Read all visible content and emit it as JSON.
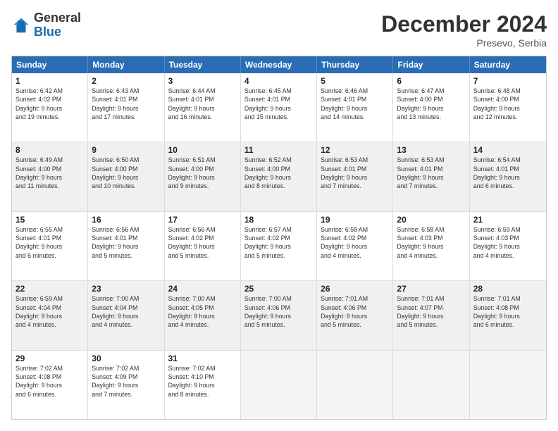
{
  "logo": {
    "general": "General",
    "blue": "Blue"
  },
  "title": "December 2024",
  "location": "Presevo, Serbia",
  "days_of_week": [
    "Sunday",
    "Monday",
    "Tuesday",
    "Wednesday",
    "Thursday",
    "Friday",
    "Saturday"
  ],
  "weeks": [
    [
      {
        "day": "1",
        "info": "Sunrise: 6:42 AM\nSunset: 4:02 PM\nDaylight: 9 hours\nand 19 minutes."
      },
      {
        "day": "2",
        "info": "Sunrise: 6:43 AM\nSunset: 4:01 PM\nDaylight: 9 hours\nand 17 minutes."
      },
      {
        "day": "3",
        "info": "Sunrise: 6:44 AM\nSunset: 4:01 PM\nDaylight: 9 hours\nand 16 minutes."
      },
      {
        "day": "4",
        "info": "Sunrise: 6:45 AM\nSunset: 4:01 PM\nDaylight: 9 hours\nand 15 minutes."
      },
      {
        "day": "5",
        "info": "Sunrise: 6:46 AM\nSunset: 4:01 PM\nDaylight: 9 hours\nand 14 minutes."
      },
      {
        "day": "6",
        "info": "Sunrise: 6:47 AM\nSunset: 4:00 PM\nDaylight: 9 hours\nand 13 minutes."
      },
      {
        "day": "7",
        "info": "Sunrise: 6:48 AM\nSunset: 4:00 PM\nDaylight: 9 hours\nand 12 minutes."
      }
    ],
    [
      {
        "day": "8",
        "info": "Sunrise: 6:49 AM\nSunset: 4:00 PM\nDaylight: 9 hours\nand 11 minutes."
      },
      {
        "day": "9",
        "info": "Sunrise: 6:50 AM\nSunset: 4:00 PM\nDaylight: 9 hours\nand 10 minutes."
      },
      {
        "day": "10",
        "info": "Sunrise: 6:51 AM\nSunset: 4:00 PM\nDaylight: 9 hours\nand 9 minutes."
      },
      {
        "day": "11",
        "info": "Sunrise: 6:52 AM\nSunset: 4:00 PM\nDaylight: 9 hours\nand 8 minutes."
      },
      {
        "day": "12",
        "info": "Sunrise: 6:53 AM\nSunset: 4:01 PM\nDaylight: 9 hours\nand 7 minutes."
      },
      {
        "day": "13",
        "info": "Sunrise: 6:53 AM\nSunset: 4:01 PM\nDaylight: 9 hours\nand 7 minutes."
      },
      {
        "day": "14",
        "info": "Sunrise: 6:54 AM\nSunset: 4:01 PM\nDaylight: 9 hours\nand 6 minutes."
      }
    ],
    [
      {
        "day": "15",
        "info": "Sunrise: 6:55 AM\nSunset: 4:01 PM\nDaylight: 9 hours\nand 6 minutes."
      },
      {
        "day": "16",
        "info": "Sunrise: 6:56 AM\nSunset: 4:01 PM\nDaylight: 9 hours\nand 5 minutes."
      },
      {
        "day": "17",
        "info": "Sunrise: 6:56 AM\nSunset: 4:02 PM\nDaylight: 9 hours\nand 5 minutes."
      },
      {
        "day": "18",
        "info": "Sunrise: 6:57 AM\nSunset: 4:02 PM\nDaylight: 9 hours\nand 5 minutes."
      },
      {
        "day": "19",
        "info": "Sunrise: 6:58 AM\nSunset: 4:02 PM\nDaylight: 9 hours\nand 4 minutes."
      },
      {
        "day": "20",
        "info": "Sunrise: 6:58 AM\nSunset: 4:03 PM\nDaylight: 9 hours\nand 4 minutes."
      },
      {
        "day": "21",
        "info": "Sunrise: 6:59 AM\nSunset: 4:03 PM\nDaylight: 9 hours\nand 4 minutes."
      }
    ],
    [
      {
        "day": "22",
        "info": "Sunrise: 6:59 AM\nSunset: 4:04 PM\nDaylight: 9 hours\nand 4 minutes."
      },
      {
        "day": "23",
        "info": "Sunrise: 7:00 AM\nSunset: 4:04 PM\nDaylight: 9 hours\nand 4 minutes."
      },
      {
        "day": "24",
        "info": "Sunrise: 7:00 AM\nSunset: 4:05 PM\nDaylight: 9 hours\nand 4 minutes."
      },
      {
        "day": "25",
        "info": "Sunrise: 7:00 AM\nSunset: 4:06 PM\nDaylight: 9 hours\nand 5 minutes."
      },
      {
        "day": "26",
        "info": "Sunrise: 7:01 AM\nSunset: 4:06 PM\nDaylight: 9 hours\nand 5 minutes."
      },
      {
        "day": "27",
        "info": "Sunrise: 7:01 AM\nSunset: 4:07 PM\nDaylight: 9 hours\nand 5 minutes."
      },
      {
        "day": "28",
        "info": "Sunrise: 7:01 AM\nSunset: 4:08 PM\nDaylight: 9 hours\nand 6 minutes."
      }
    ],
    [
      {
        "day": "29",
        "info": "Sunrise: 7:02 AM\nSunset: 4:08 PM\nDaylight: 9 hours\nand 6 minutes."
      },
      {
        "day": "30",
        "info": "Sunrise: 7:02 AM\nSunset: 4:09 PM\nDaylight: 9 hours\nand 7 minutes."
      },
      {
        "day": "31",
        "info": "Sunrise: 7:02 AM\nSunset: 4:10 PM\nDaylight: 9 hours\nand 8 minutes."
      },
      {
        "day": "",
        "info": ""
      },
      {
        "day": "",
        "info": ""
      },
      {
        "day": "",
        "info": ""
      },
      {
        "day": "",
        "info": ""
      }
    ]
  ]
}
